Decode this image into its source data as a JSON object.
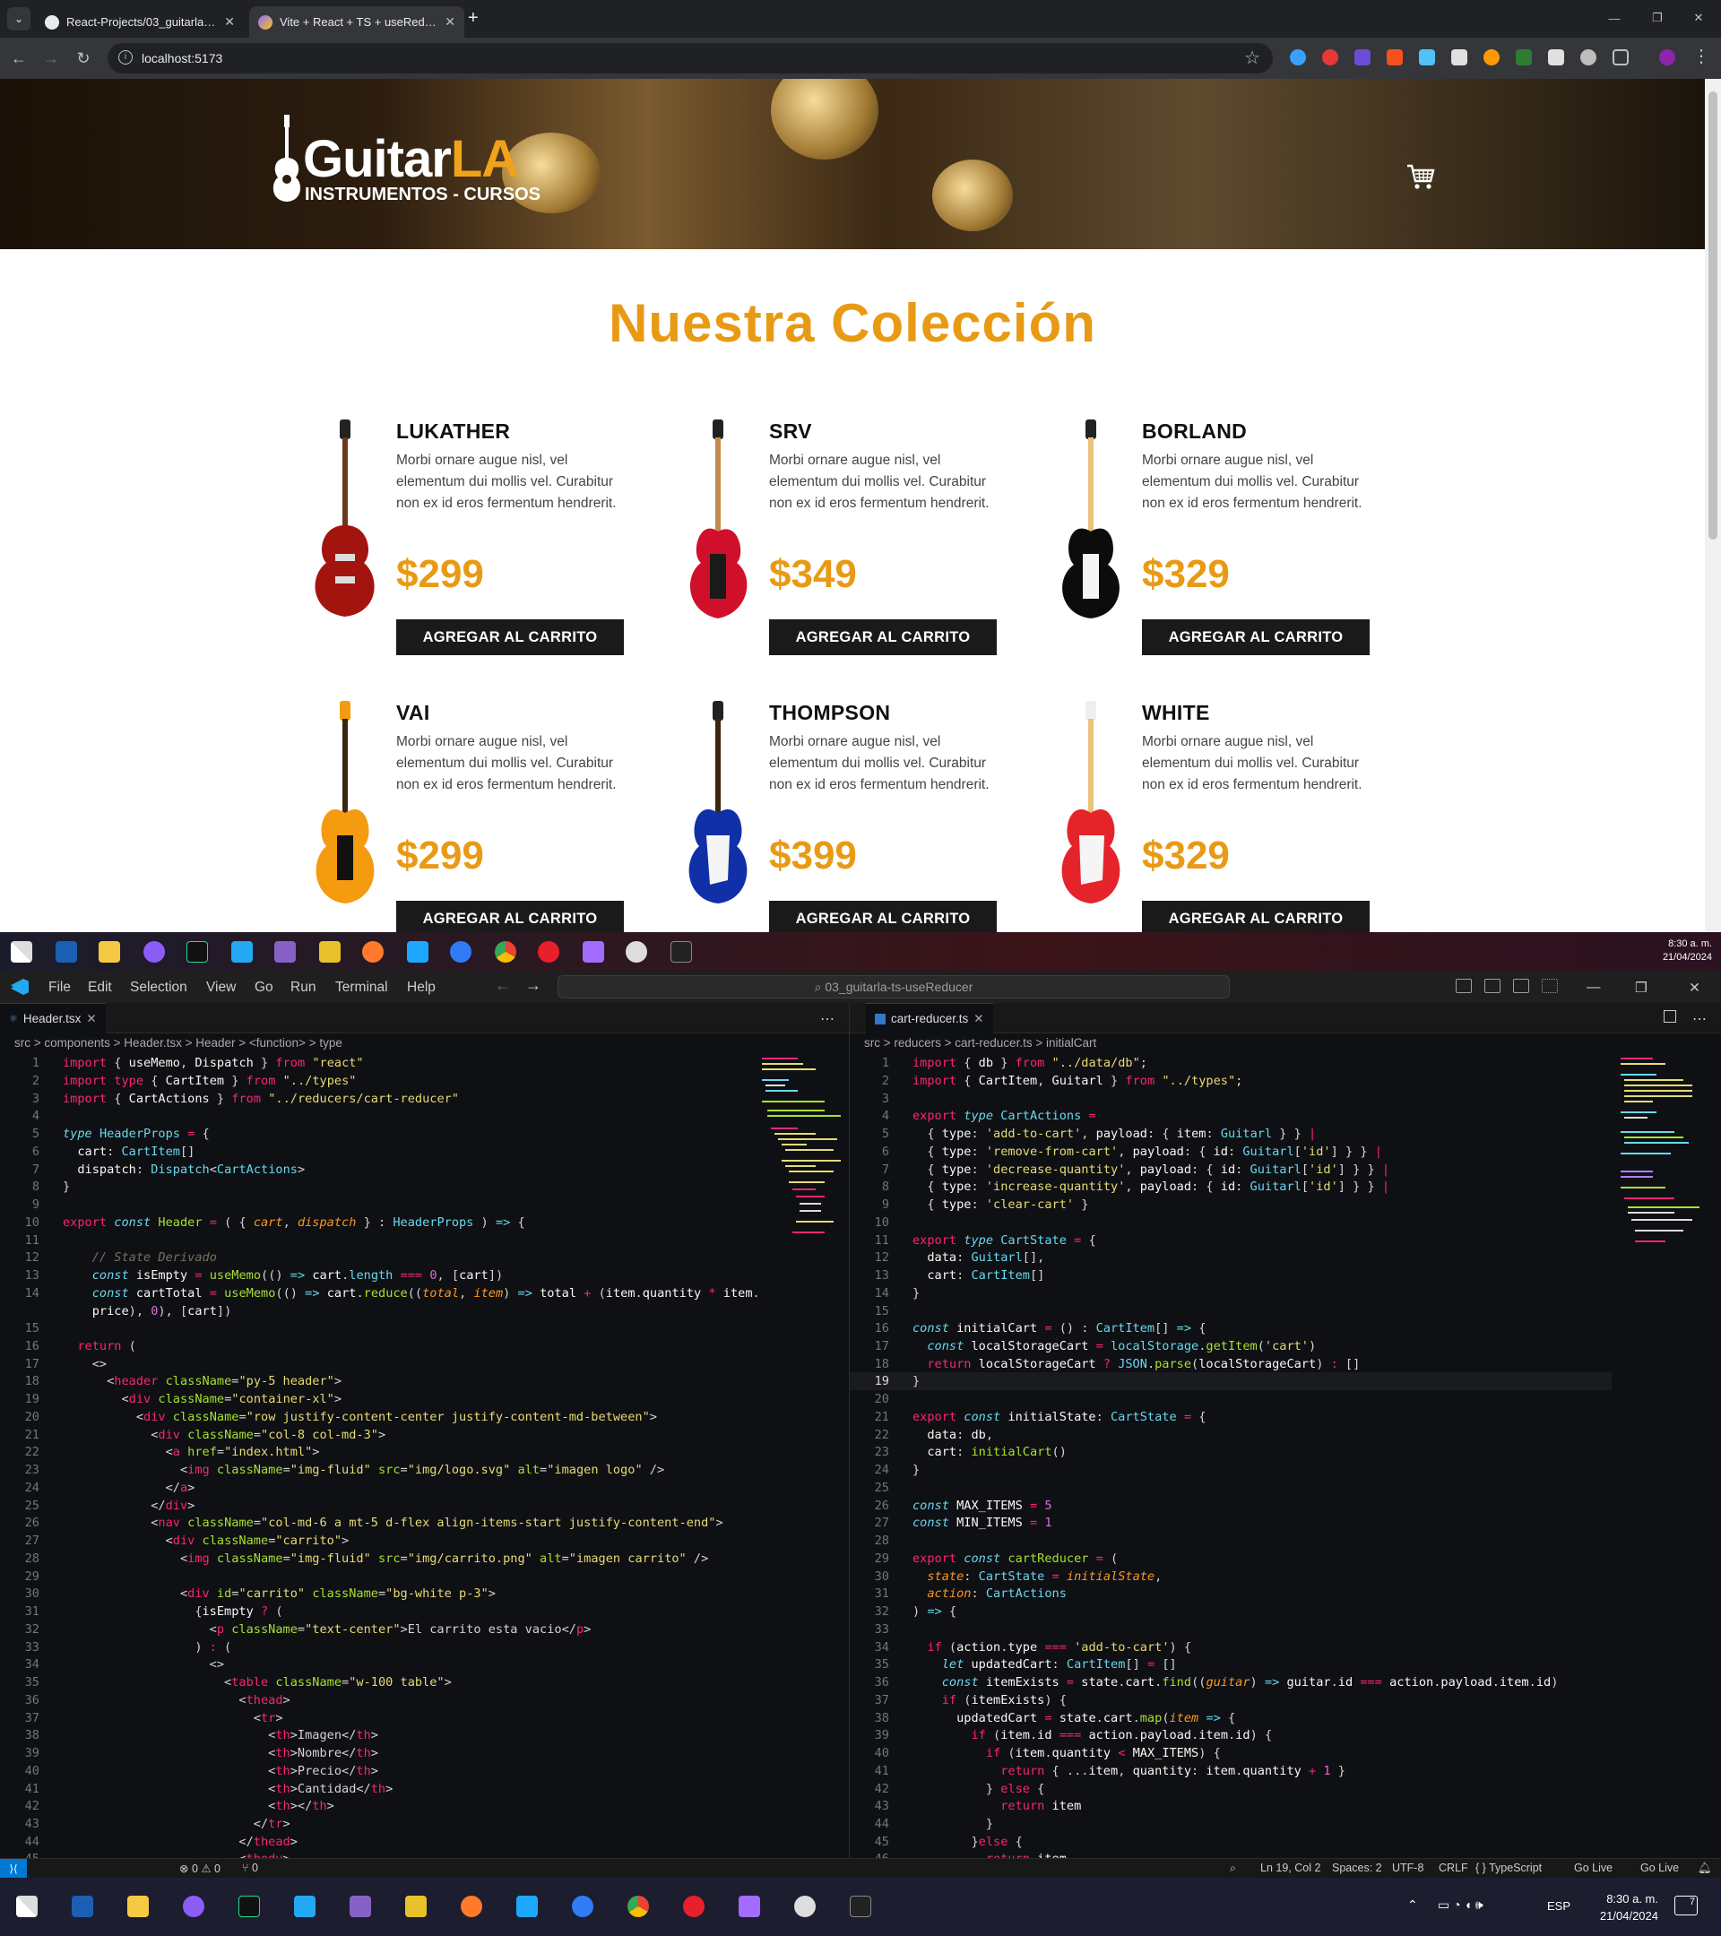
{
  "browser": {
    "tabs": [
      {
        "title": "React-Projects/03_guitarla-ts-u...",
        "close": "✕"
      },
      {
        "title": "Vite + React + TS + useReducer",
        "close": "✕"
      }
    ],
    "new_tab": "+",
    "url": "localhost:5173"
  },
  "site": {
    "logo_main": "Guitar",
    "logo_accent": "LA",
    "logo_sub": "INSTRUMENTOS - CURSOS",
    "section_title": "Nuestra Colección",
    "button_label": "AGREGAR AL CARRITO",
    "products": [
      {
        "name": "LUKATHER",
        "desc": "Morbi ornare augue nisl, vel elementum dui mollis vel. Curabitur non ex id eros fermentum hendrerit.",
        "price": "$299"
      },
      {
        "name": "SRV",
        "desc": "Morbi ornare augue nisl, vel elementum dui mollis vel. Curabitur non ex id eros fermentum hendrerit.",
        "price": "$349"
      },
      {
        "name": "BORLAND",
        "desc": "Morbi ornare augue nisl, vel elementum dui mollis vel. Curabitur non ex id eros fermentum hendrerit.",
        "price": "$329"
      },
      {
        "name": "VAI",
        "desc": "Morbi ornare augue nisl, vel elementum dui mollis vel. Curabitur non ex id eros fermentum hendrerit.",
        "price": "$299"
      },
      {
        "name": "THOMPSON",
        "desc": "Morbi ornare augue nisl, vel elementum dui mollis vel. Curabitur non ex id eros fermentum hendrerit.",
        "price": "$399"
      },
      {
        "name": "WHITE",
        "desc": "Morbi ornare augue nisl, vel elementum dui mollis vel. Curabitur non ex id eros fermentum hendrerit.",
        "price": "$329"
      }
    ]
  },
  "taskbar_top": {
    "time": "8:30 a. m.",
    "date": "21/04/2024"
  },
  "vscode": {
    "menu": [
      "File",
      "Edit",
      "Selection",
      "View",
      "Go",
      "Run",
      "Terminal",
      "Help"
    ],
    "search": "03_guitarla-ts-useReducer",
    "left": {
      "tab": "Header.tsx",
      "crumbs": "src  >  components  >  Header.tsx  >  Header  >  <function>  >  type"
    },
    "right": {
      "tab": "cart-reducer.ts",
      "crumbs": "src  >  reducers  >  cart-reducer.ts  >  initialCart"
    },
    "status": {
      "errors": "⊗ 0 ⚠ 0",
      "ports": "⑂ 0",
      "position": "Ln 19, Col 2",
      "spaces": "Spaces: 2",
      "encoding": "UTF-8",
      "eol": "CRLF",
      "language": "{ } TypeScript",
      "golive1": "Go Live",
      "golive2": "Go Live"
    }
  },
  "taskbar_bottom": {
    "lang": "ESP",
    "time": "8:30 a. m.",
    "date": "21/04/2024",
    "notif": "7"
  },
  "colors": {
    "accent": "#e99a14",
    "vscode_bg": "#0f1014",
    "taskbar": "#1b1c2b"
  }
}
